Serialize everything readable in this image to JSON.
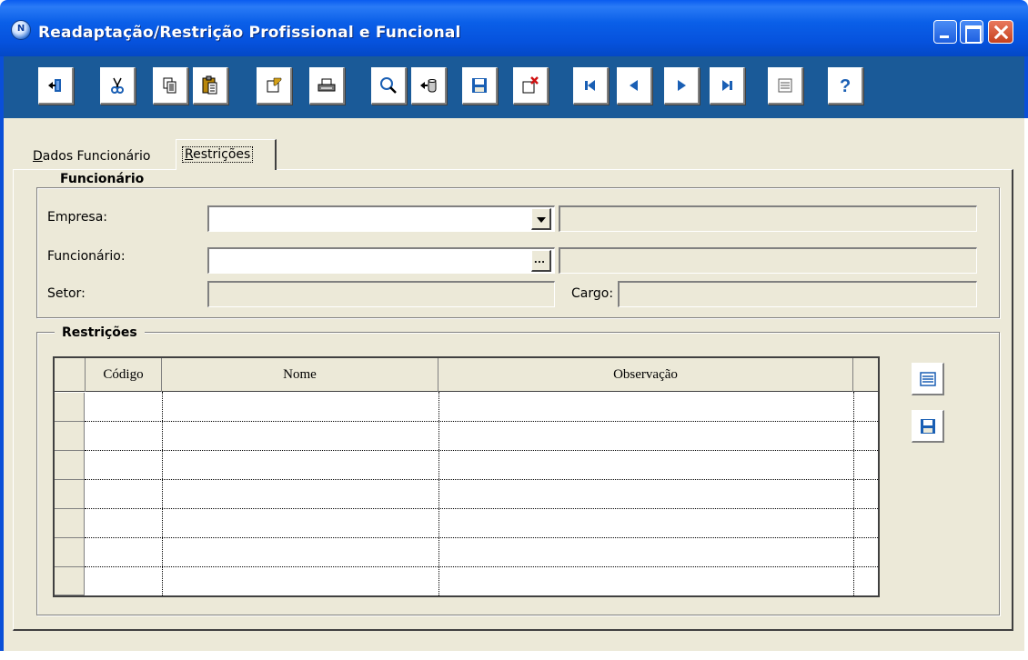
{
  "window": {
    "title": "Readaptação/Restrição Profissional e Funcional",
    "app_icon_letter": "N"
  },
  "toolbar": {
    "buttons": [
      {
        "name": "exit",
        "icon": "exit-door-icon"
      },
      {
        "name": "cut",
        "icon": "scissors-icon"
      },
      {
        "name": "copy",
        "icon": "copy-icon"
      },
      {
        "name": "paste",
        "icon": "paste-icon"
      },
      {
        "name": "new",
        "icon": "new-record-icon"
      },
      {
        "name": "print",
        "icon": "printer-icon"
      },
      {
        "name": "search",
        "icon": "magnifier-icon"
      },
      {
        "name": "import",
        "icon": "import-icon"
      },
      {
        "name": "save",
        "icon": "floppy-disk-icon"
      },
      {
        "name": "delete",
        "icon": "delete-icon"
      },
      {
        "name": "first",
        "icon": "first-record-icon"
      },
      {
        "name": "previous",
        "icon": "previous-record-icon"
      },
      {
        "name": "next",
        "icon": "next-record-icon"
      },
      {
        "name": "last",
        "icon": "last-record-icon"
      },
      {
        "name": "list",
        "icon": "table-list-icon"
      },
      {
        "name": "help",
        "icon": "help-question-icon"
      }
    ]
  },
  "tabs": {
    "dados_first": "D",
    "dados_rest": "ados Funcionário",
    "restricoes_first": "R",
    "restricoes_rest": "estrições",
    "active": "Restrições"
  },
  "funcionario_group": {
    "title": "Funcionário",
    "empresa_label": "Empresa:",
    "empresa_value": "",
    "empresa_name": "",
    "funcionario_label": "Funcionário:",
    "funcionario_value": "",
    "funcionario_name": "",
    "setor_label": "Setor:",
    "setor_value": "",
    "cargo_label": "Cargo:",
    "cargo_value": "",
    "lookup_button": "..."
  },
  "restricoes_group": {
    "title": "Restrições",
    "columns": [
      "Código",
      "Nome",
      "Observação"
    ],
    "rows": []
  },
  "colors": {
    "title_bar": "#0a5cf0",
    "toolbar_bg": "#1a5a98",
    "client_bg": "#ece9d8",
    "icon_blue": "#1a5fb4"
  }
}
